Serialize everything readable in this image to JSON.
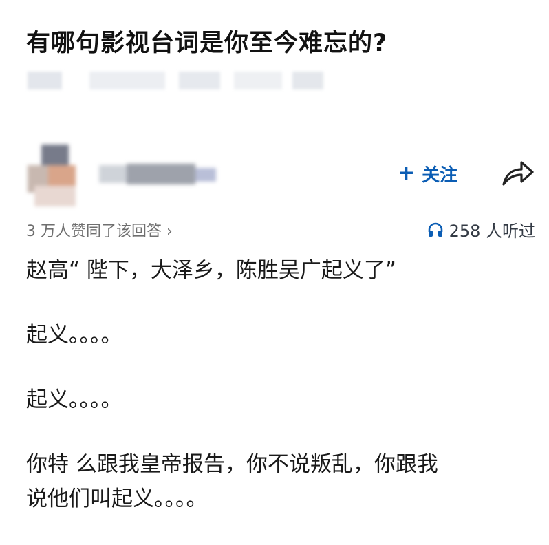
{
  "question": {
    "title": "有哪句影视台词是你至今难忘的?"
  },
  "author": {
    "follow_label": "关注",
    "follow_icon": "plus-icon",
    "share_icon": "share-arrow-icon"
  },
  "stats": {
    "upvote_text": "3 万人赞同了该回答 ›",
    "listen_icon": "headphones-icon",
    "listen_text": "258 人听过"
  },
  "answer": {
    "paragraphs": [
      "赵高“ 陛下，大泽乡，陈胜吴广起义了”",
      "起义。。。。",
      "起义。。。。",
      "你特 么跟我皇帝报告，你不说叛乱，你跟我\n说他们叫起义。。。。"
    ]
  },
  "colors": {
    "accent": "#0b5db4",
    "text": "#1a1a1a",
    "muted": "#6f6f6f"
  }
}
